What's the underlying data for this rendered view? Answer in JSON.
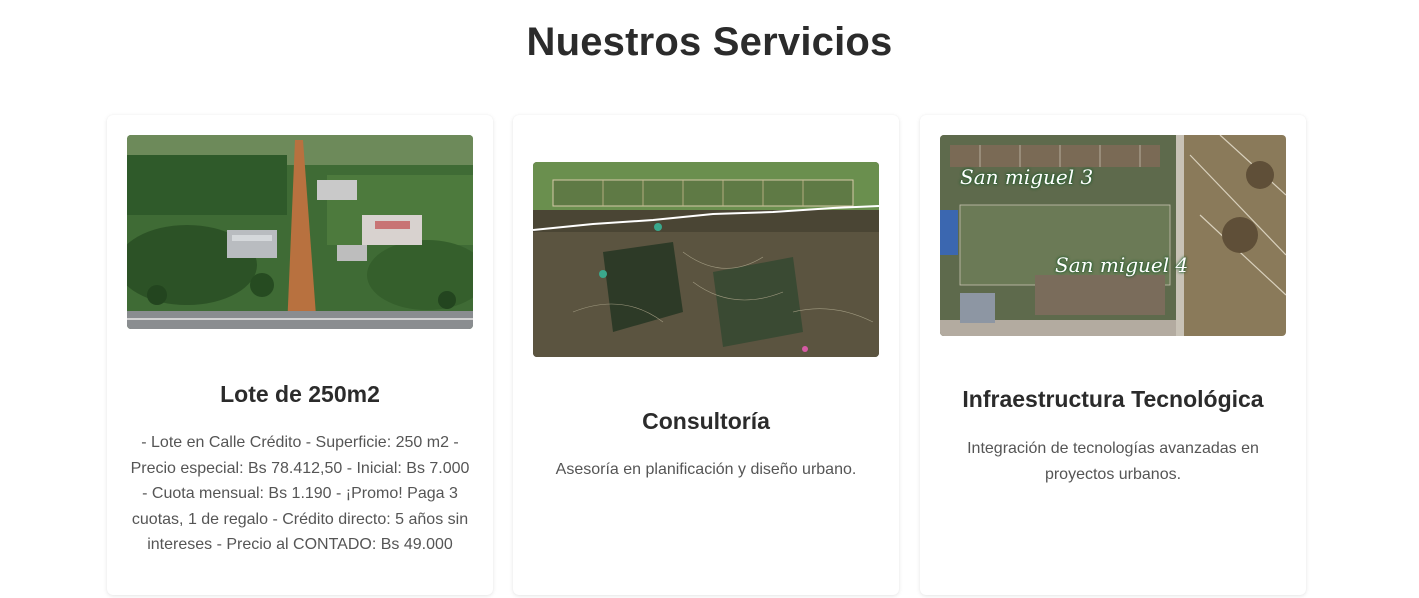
{
  "section": {
    "title": "Nuestros Servicios"
  },
  "cards": [
    {
      "image_alt": "aerial-photo-lot",
      "title": "Lote de 250m2",
      "description": "- Lote en Calle Crédito - Superficie: 250 m2 - Precio especial: Bs 78.412,50 - Inicial: Bs 7.000 - Cuota mensual: Bs 1.190 - ¡Promo! Paga 3 cuotas, 1 de regalo - Crédito directo: 5 años sin intereses - Precio al CONTADO: Bs 49.000"
    },
    {
      "image_alt": "satellite-map-consulting",
      "title": "Consultoría",
      "description": "Asesoría en planificación y diseño urbano."
    },
    {
      "image_alt": "satellite-map-san-miguel",
      "title": "Infraestructura Tecnológica",
      "description": "Integración de tecnologías avanzadas en proyectos urbanos.",
      "map_labels": [
        "San miguel 3",
        "San miguel 4"
      ]
    }
  ]
}
